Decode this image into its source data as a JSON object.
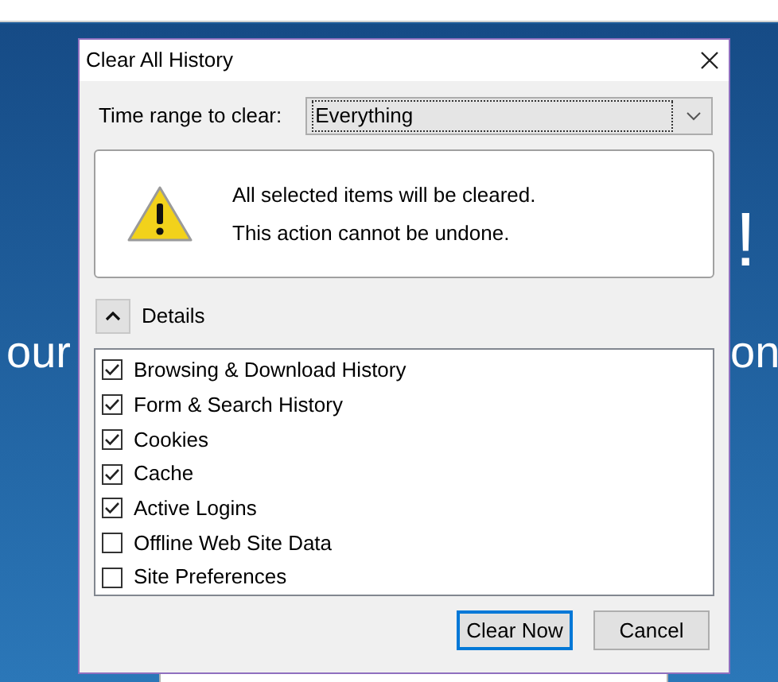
{
  "page": {
    "headline_end": "!",
    "subline_start": "our",
    "subline_end": "on"
  },
  "dialog": {
    "title": "Clear All History",
    "time_range": {
      "label": "Time range to clear:",
      "value": "Everything"
    },
    "warning": [
      "All selected items will be cleared.",
      "This action cannot be undone."
    ],
    "details": {
      "label": "Details",
      "expanded": true
    },
    "items": [
      {
        "label": "Browsing & Download History",
        "checked": true
      },
      {
        "label": "Form & Search History",
        "checked": true
      },
      {
        "label": "Cookies",
        "checked": true
      },
      {
        "label": "Cache",
        "checked": true
      },
      {
        "label": "Active Logins",
        "checked": true
      },
      {
        "label": "Offline Web Site Data",
        "checked": false
      },
      {
        "label": "Site Preferences",
        "checked": false
      }
    ],
    "buttons": [
      {
        "label": "Clear Now",
        "default": true
      },
      {
        "label": "Cancel",
        "default": false
      }
    ]
  }
}
